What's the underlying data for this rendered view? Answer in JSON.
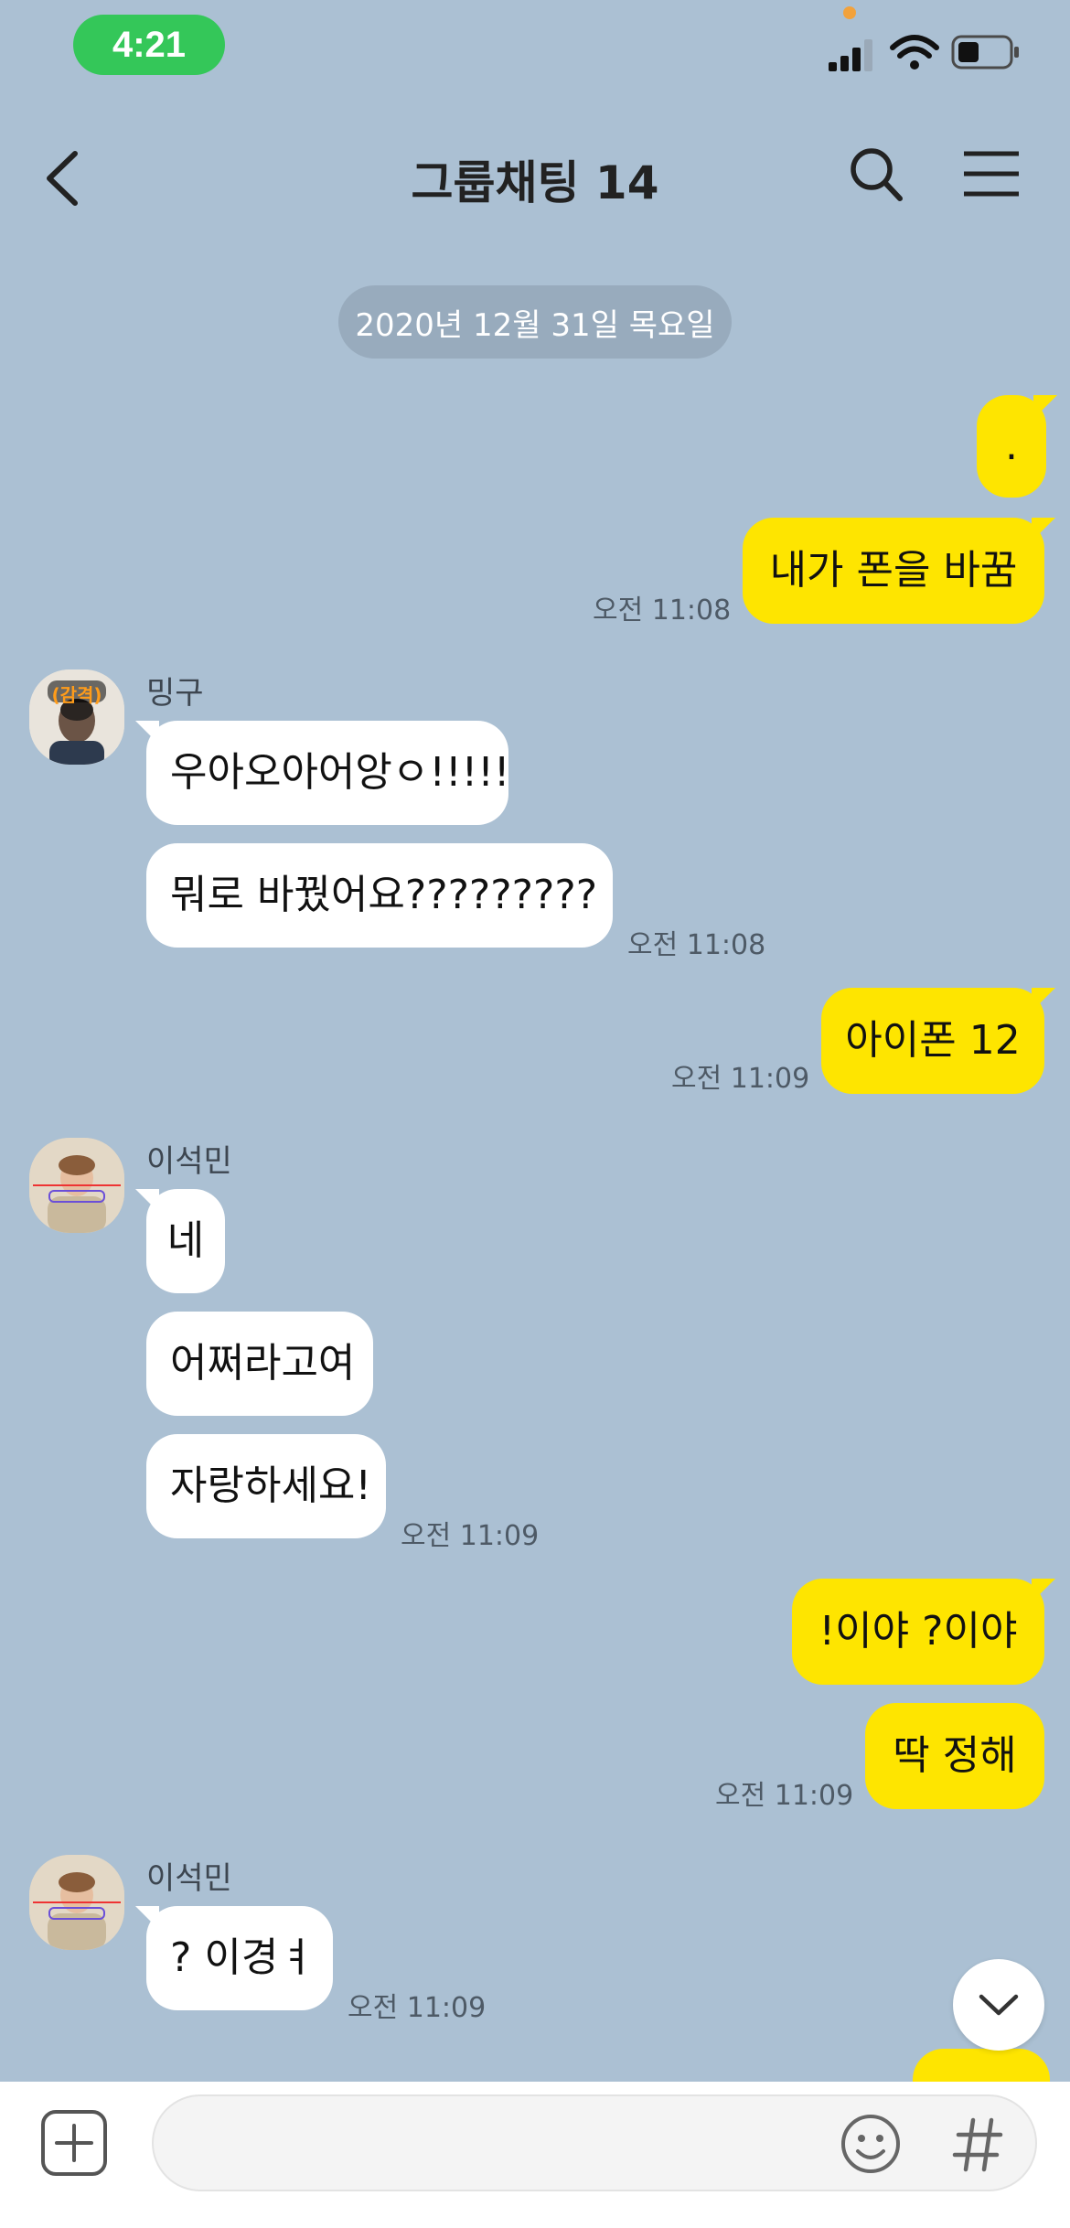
{
  "status_bar": {
    "time": "4:21"
  },
  "header": {
    "title": "그룹채팅 14"
  },
  "date_divider": "2020년 12월 31일 목요일",
  "messages": [
    {
      "sender": "me",
      "text": "."
    },
    {
      "sender": "me",
      "text": "내가 폰을 바꿈",
      "time": "오전 11:08"
    },
    {
      "sender": "밍구",
      "avatar_badge": "(감격)",
      "text": "우아오아어앙ㅇ!!!!!"
    },
    {
      "sender": "밍구",
      "text": "뭐로 바꿨어요?????????",
      "time": "오전 11:08"
    },
    {
      "sender": "me",
      "text": "아이폰 12",
      "time": "오전 11:09"
    },
    {
      "sender": "이석민",
      "text": "네"
    },
    {
      "sender": "이석민",
      "text": "어쩌라고여"
    },
    {
      "sender": "이석민",
      "text": "자랑하세요!",
      "time": "오전 11:09"
    },
    {
      "sender": "me",
      "text": "!이야 ?이야"
    },
    {
      "sender": "me",
      "text": "딱 정해",
      "time": "오전 11:09"
    },
    {
      "sender": "이석민",
      "text": "? 이경ㅕ",
      "time": "오전 11:09"
    }
  ],
  "icons": {
    "back": "chevron-left-icon",
    "search": "search-icon",
    "menu": "menu-icon",
    "add": "plus-square-icon",
    "emoji": "emoji-icon",
    "hashtag": "hashtag-icon",
    "scroll_down": "chevron-down-icon"
  },
  "colors": {
    "background": "#abc0d3",
    "my_bubble": "#fee500",
    "their_bubble": "#ffffff",
    "time_pill": "#34c759"
  }
}
